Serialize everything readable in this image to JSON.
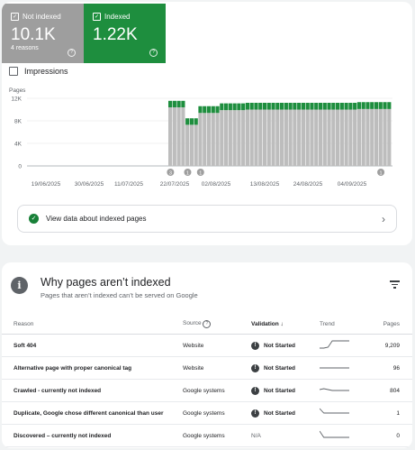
{
  "tiles": {
    "not_indexed": {
      "label": "Not indexed",
      "value": "10.1K",
      "sub": "4 reasons",
      "color": "#9e9e9e"
    },
    "indexed": {
      "label": "Indexed",
      "value": "1.22K",
      "color": "#1e8e3e"
    }
  },
  "impressions_label": "Impressions",
  "chart_data": {
    "type": "bar",
    "ylabel": "Pages",
    "y_ticks": [
      "12K",
      "8K",
      "4K",
      "0"
    ],
    "ylim": [
      0,
      12000
    ],
    "x_ticks": [
      "19/06/2025",
      "30/06/2025",
      "11/07/2025",
      "22/07/2025",
      "02/08/2025",
      "13/08/2025",
      "24/08/2025",
      "04/09/2025"
    ],
    "stacked": true,
    "bar_dates_start": "22/07/2025",
    "series": [
      {
        "name": "Not indexed",
        "color": "#bdbdbd",
        "values": [
          10400,
          10400,
          10400,
          10400,
          7300,
          7300,
          7300,
          9400,
          9400,
          9400,
          9400,
          9400,
          9900,
          9900,
          9900,
          9900,
          9900,
          9900,
          10000,
          10000,
          10000,
          10000,
          10000,
          10000,
          10000,
          10000,
          10000,
          10000,
          10000,
          10000,
          10000,
          10000,
          10000,
          10000,
          10000,
          10000,
          10000,
          10000,
          10000,
          10000,
          10000,
          10000,
          10000,
          10000,
          10100,
          10100,
          10100,
          10100,
          10100,
          10100,
          10100,
          10100
        ]
      },
      {
        "name": "Indexed",
        "color": "#1e8e3e",
        "values": [
          1150,
          1150,
          1150,
          1150,
          1150,
          1150,
          1150,
          1200,
          1200,
          1200,
          1200,
          1200,
          1200,
          1200,
          1200,
          1200,
          1200,
          1200,
          1200,
          1200,
          1200,
          1200,
          1200,
          1200,
          1200,
          1200,
          1200,
          1200,
          1200,
          1200,
          1200,
          1200,
          1200,
          1200,
          1200,
          1200,
          1200,
          1200,
          1200,
          1200,
          1200,
          1200,
          1200,
          1200,
          1220,
          1220,
          1220,
          1220,
          1220,
          1220,
          1220,
          1220
        ]
      }
    ],
    "annotations": [
      {
        "label": "3",
        "after_bar": 0
      },
      {
        "label": "1",
        "after_bar": 4
      },
      {
        "label": "1",
        "after_bar": 7
      },
      {
        "label": "1",
        "after_bar": 49
      }
    ]
  },
  "view_link": "View data about indexed pages",
  "why": {
    "title": "Why pages aren’t indexed",
    "subtitle": "Pages that aren’t indexed can’t be served on Google",
    "columns": [
      "Reason",
      "Source",
      "Validation",
      "Trend",
      "Pages"
    ],
    "rows": [
      {
        "reason": "Soft 404",
        "source": "Website",
        "validation": "Not Started",
        "pages": "9,209",
        "trend": [
          2,
          2,
          3,
          10,
          10,
          10,
          10,
          10
        ]
      },
      {
        "reason": "Alternative page with proper canonical tag",
        "source": "Website",
        "validation": "Not Started",
        "pages": "96",
        "trend": [
          5,
          5,
          5,
          5,
          5,
          5,
          5,
          5
        ]
      },
      {
        "reason": "Crawled - currently not indexed",
        "source": "Google systems",
        "validation": "Not Started",
        "pages": "804",
        "trend": [
          6,
          7,
          6,
          5,
          5,
          5,
          5,
          5
        ]
      },
      {
        "reason": "Duplicate, Google chose different canonical than user",
        "source": "Google systems",
        "validation": "Not Started",
        "pages": "1",
        "trend": [
          10,
          5,
          5,
          5,
          5,
          5,
          5,
          5
        ]
      },
      {
        "reason": "Discovered – currently not indexed",
        "source": "Google systems",
        "validation": "N/A",
        "pages": "0",
        "trend": [
          10,
          3,
          3,
          3,
          3,
          3,
          3,
          3
        ]
      }
    ]
  }
}
